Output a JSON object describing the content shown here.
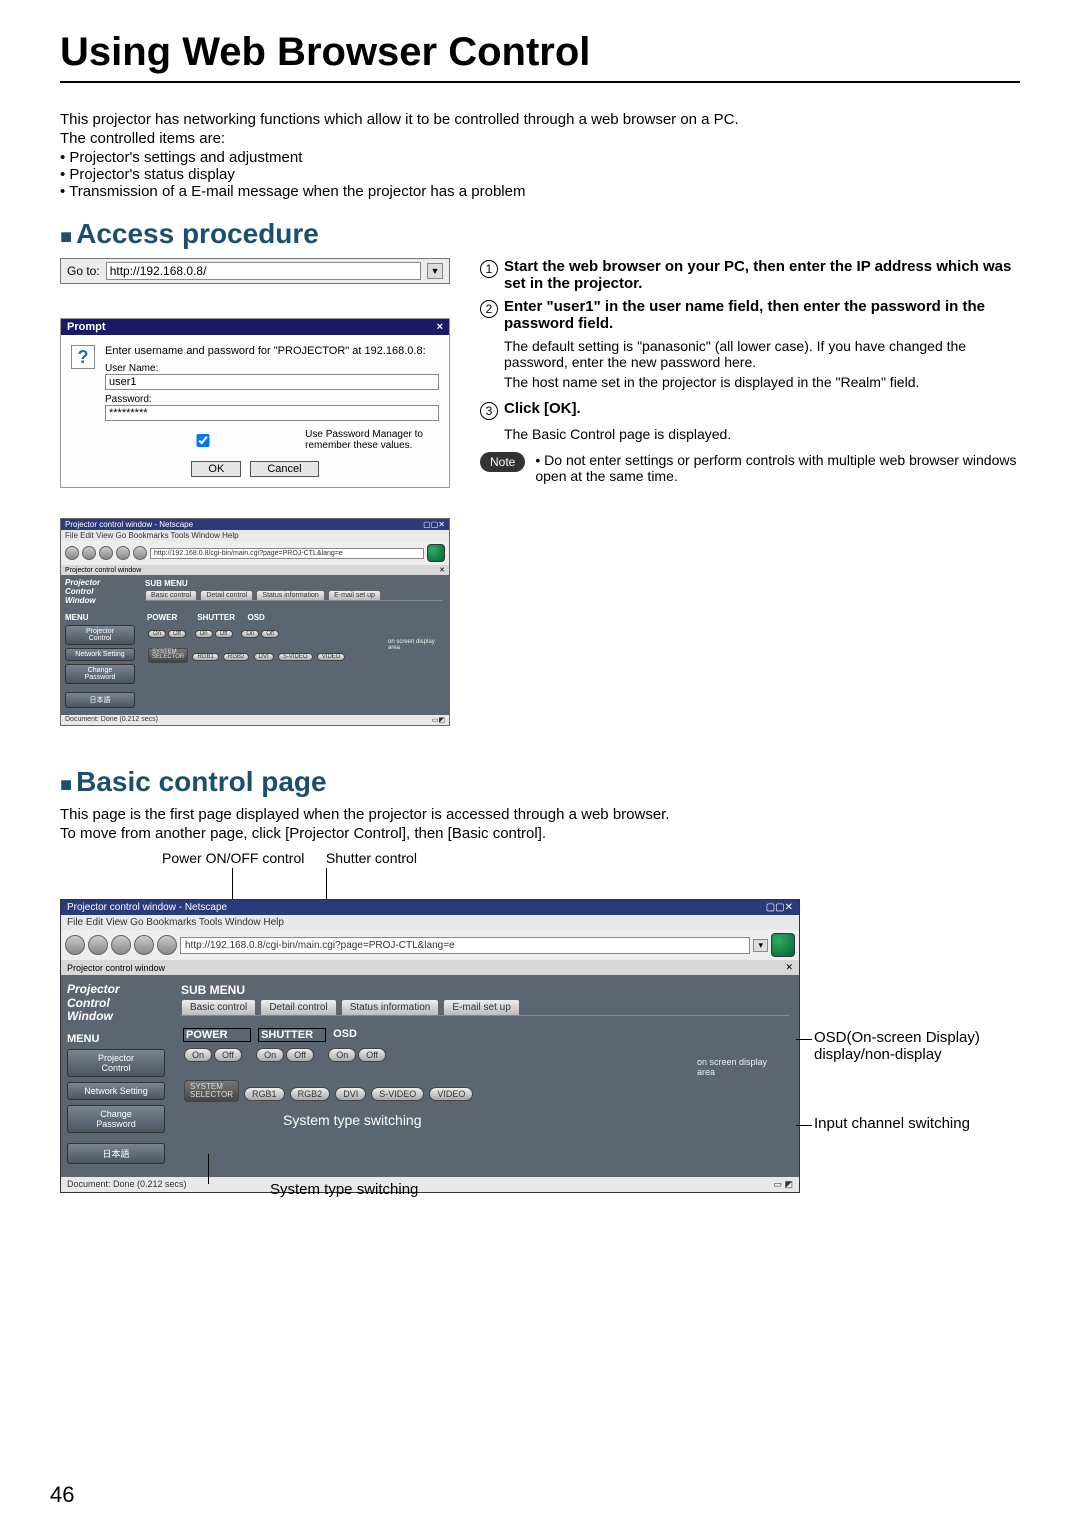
{
  "page_number": "46",
  "title": "Using Web Browser Control",
  "intro": {
    "line1": "This projector has networking functions which allow it to be controlled through a web browser on a PC.",
    "line2": "The controlled items are:",
    "b1": "• Projector's settings and adjustment",
    "b2": "• Projector's status display",
    "b3": "• Transmission of a E-mail message when the projector has a problem"
  },
  "section1": "Access procedure",
  "goto": {
    "label": "Go to:",
    "value": "http://192.168.0.8/"
  },
  "prompt": {
    "title": "Prompt",
    "msg": "Enter username and password for \"PROJECTOR\" at 192.168.0.8:",
    "user_label": "User Name:",
    "user_value": "user1",
    "pass_label": "Password:",
    "pass_value": "*********",
    "chk": "Use Password Manager to remember these values.",
    "ok": "OK",
    "cancel": "Cancel"
  },
  "shot": {
    "wintitle": "Projector control window - Netscape",
    "menus": "File  Edit  View  Go  Bookmarks  Tools  Window  Help",
    "url": "http://192.168.0.8/cgi-bin/main.cgi?page=PROJ-CTL&lang=e",
    "tabtitle": "Projector control window",
    "sideTitle": "Projector\nControl\nWindow",
    "menu_label": "MENU",
    "side_projctrl": "Projector\nControl",
    "side_netset": "Network Setting",
    "side_chpw": "Change\nPassword",
    "side_jp": "日本語",
    "submenu": "SUB MENU",
    "tab_basic": "Basic control",
    "tab_detail": "Detail control",
    "tab_status": "Status information",
    "tab_email": "E-mail set up",
    "grp_power": "POWER",
    "grp_shutter": "SHUTTER",
    "grp_osd": "OSD",
    "on": "On",
    "off": "Off",
    "sysel": "SYSTEM\nSELECTOR",
    "rgb1": "RGB1",
    "rgb2": "RGB2",
    "dvi": "DVI",
    "svideo": "S-VIDEO",
    "video": "VIDEO",
    "osd_area": "on screen display\narea",
    "status": "Document: Done (0.212 secs)"
  },
  "steps": {
    "s1": "Start the web browser on your PC, then enter the IP address which was set in the projector.",
    "s2": "Enter \"user1\" in the user name field, then enter the password in the password field.",
    "s2body_a": "The default setting is \"panasonic\" (all lower case). If you have changed the password, enter the new password here.",
    "s2body_b": "The host name set in the projector is displayed in the \"Realm\" field.",
    "s3": "Click [OK].",
    "s3body": "The Basic Control page is displayed.",
    "note_label": "Note",
    "note_txt": "Do not enter settings or perform controls with multiple web browser windows open at the same time."
  },
  "section2": "Basic control page",
  "basic_intro1": "This page is the first page displayed when the projector is accessed through a web browser.",
  "basic_intro2": "To move from another page, click [Projector Control], then [Basic control].",
  "callouts": {
    "power": "Power ON/OFF control",
    "shutter": "Shutter control",
    "osd": "OSD(On-screen Display)\ndisplay/non-display",
    "input": "Input channel switching",
    "system": "System type switching"
  }
}
